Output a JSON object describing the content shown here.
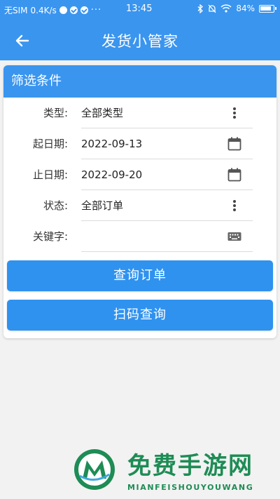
{
  "status_bar": {
    "carrier": "无SIM",
    "speed": "0.4K/s",
    "time": "13:45",
    "battery": "84%",
    "more": "···"
  },
  "header": {
    "title": "发货小管家"
  },
  "filter": {
    "title": "筛选条件",
    "rows": [
      {
        "label": "类型:",
        "value": "全部类型",
        "icon": "more-vert-icon"
      },
      {
        "label": "起日期:",
        "value": "2022-09-13",
        "icon": "calendar-icon"
      },
      {
        "label": "止日期:",
        "value": "2022-09-20",
        "icon": "calendar-icon"
      },
      {
        "label": "状态:",
        "value": "全部订单",
        "icon": "more-vert-icon"
      },
      {
        "label": "关键字:",
        "value": "",
        "icon": "keyboard-icon"
      }
    ],
    "query_button": "查询订单",
    "scan_button": "扫码查询"
  },
  "watermark": {
    "text_cn": "免费手游网",
    "text_en": "MIANFEISHOUYOUWANG"
  },
  "colors": {
    "primary": "#3a95ef",
    "button": "#2f92ef",
    "watermark": "#1e8c55"
  }
}
